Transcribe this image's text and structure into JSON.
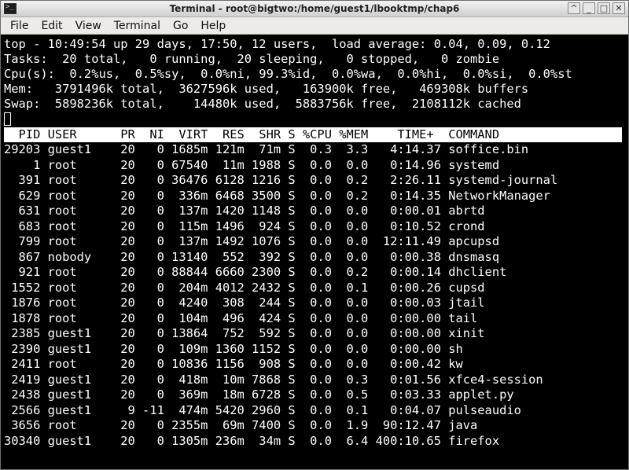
{
  "window": {
    "title": "Terminal - root@bigtwo:/home/guest1/lbooktmp/chap6",
    "controls": [
      "^",
      "_",
      "□",
      "✕"
    ]
  },
  "menu": [
    "File",
    "Edit",
    "View",
    "Terminal",
    "Go",
    "Help"
  ],
  "summary": [
    "top - 10:49:54 up 29 days, 17:50, 12 users,  load average: 0.04, 0.09, 0.12",
    "Tasks:  20 total,   0 running,  20 sleeping,   0 stopped,   0 zombie",
    "Cpu(s):  0.2%us,  0.5%sy,  0.0%ni, 99.3%id,  0.0%wa,  0.0%hi,  0.0%si,  0.0%st",
    "Mem:   3791496k total,  3627596k used,   163900k free,   469308k buffers",
    "Swap:  5898236k total,    14480k used,  5883756k free,  2108112k cached"
  ],
  "table_header": "  PID USER      PR  NI  VIRT  RES  SHR S %CPU %MEM    TIME+  COMMAND",
  "processes": [
    "29203 guest1    20   0 1685m 121m  71m S  0.3  3.3   4:14.37 soffice.bin",
    "    1 root      20   0 67540  11m 1988 S  0.0  0.0   0:14.96 systemd",
    "  391 root      20   0 36476 6128 1216 S  0.0  0.2   2:26.11 systemd-journal",
    "  629 root      20   0  336m 6468 3500 S  0.0  0.2   0:14.35 NetworkManager",
    "  631 root      20   0  137m 1420 1148 S  0.0  0.0   0:00.01 abrtd",
    "  683 root      20   0  115m 1496  924 S  0.0  0.0   0:10.52 crond",
    "  799 root      20   0  137m 1492 1076 S  0.0  0.0  12:11.49 apcupsd",
    "  867 nobody    20   0 13140  552  392 S  0.0  0.0   0:00.38 dnsmasq",
    "  921 root      20   0 88844 6660 2300 S  0.0  0.2   0:00.14 dhclient",
    " 1552 root      20   0  204m 4012 2432 S  0.0  0.1   0:00.26 cupsd",
    " 1876 root      20   0  4240  308  244 S  0.0  0.0   0:00.03 jtail",
    " 1878 root      20   0  104m  496  424 S  0.0  0.0   0:00.00 tail",
    " 2385 guest1    20   0 13864  752  592 S  0.0  0.0   0:00.00 xinit",
    " 2390 guest1    20   0  109m 1360 1152 S  0.0  0.0   0:00.00 sh",
    " 2411 root      20   0 10836 1156  908 S  0.0  0.0   0:00.42 kw",
    " 2419 guest1    20   0  418m  10m 7868 S  0.0  0.3   0:01.56 xfce4-session",
    " 2438 guest1    20   0  369m  18m 6728 S  0.0  0.5   0:03.33 applet.py",
    " 2566 guest1     9 -11  474m 5420 2960 S  0.0  0.1   0:04.07 pulseaudio",
    " 3656 root      20   0 2355m  69m 7400 S  0.0  1.9  90:12.47 java",
    "30340 guest1    20   0 1305m 236m  34m S  0.0  6.4 400:10.65 firefox"
  ],
  "colors": {
    "terminal_bg": "#000000",
    "terminal_fg": "#ffffff",
    "header_bg": "#ffffff",
    "header_fg": "#000000"
  }
}
